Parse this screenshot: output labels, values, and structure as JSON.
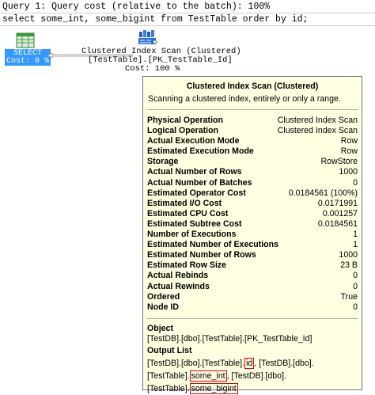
{
  "query": {
    "header": "Query 1: Query cost (relative to the batch): 100%",
    "statement": "select some_int, some_bigint from TestTable order by id;"
  },
  "select_node": {
    "label": "SELECT",
    "cost": "Cost: 0 %"
  },
  "scan_node": {
    "title": "Clustered Index Scan (Clustered)",
    "object": "[TestTable].[PK_TestTable_Id]",
    "cost": "Cost: 100 %"
  },
  "tooltip": {
    "title": "Clustered Index Scan (Clustered)",
    "description": "Scanning a clustered index, entirely or only a range.",
    "properties": [
      {
        "key": "Physical Operation",
        "value": "Clustered Index Scan"
      },
      {
        "key": "Logical Operation",
        "value": "Clustered Index Scan"
      },
      {
        "key": "Actual Execution Mode",
        "value": "Row"
      },
      {
        "key": "Estimated Execution Mode",
        "value": "Row"
      },
      {
        "key": "Storage",
        "value": "RowStore"
      },
      {
        "key": "Actual Number of Rows",
        "value": "1000"
      },
      {
        "key": "Actual Number of Batches",
        "value": "0"
      },
      {
        "key": "Estimated Operator Cost",
        "value": "0.0184561 (100%)"
      },
      {
        "key": "Estimated I/O Cost",
        "value": "0.0171991"
      },
      {
        "key": "Estimated CPU Cost",
        "value": "0.001257"
      },
      {
        "key": "Estimated Subtree Cost",
        "value": "0.0184561"
      },
      {
        "key": "Number of Executions",
        "value": "1"
      },
      {
        "key": "Estimated Number of Executions",
        "value": "1"
      },
      {
        "key": "Estimated Number of Rows",
        "value": "1000"
      },
      {
        "key": "Estimated Row Size",
        "value": "23 B"
      },
      {
        "key": "Actual Rebinds",
        "value": "0"
      },
      {
        "key": "Actual Rewinds",
        "value": "0"
      },
      {
        "key": "Ordered",
        "value": "True"
      },
      {
        "key": "Node ID",
        "value": "0"
      }
    ],
    "object_title": "Object",
    "object_value": "[TestDB].[dbo].[TestTable].[PK_TestTable_Id]",
    "output_title": "Output List",
    "output": {
      "p1": "[TestDB].[dbo].[TestTable].",
      "col1": "id",
      "p2": ", [TestDB].[dbo].",
      "p3": "[TestTable].",
      "col2": "some_int",
      "p4": ", [TestDB].[dbo].[TestTable].",
      "col3": "some_bigint"
    }
  },
  "colors": {
    "selected_node": "#3399ff",
    "tooltip_bg": "#ffffe1",
    "highlight": "#e00000"
  }
}
